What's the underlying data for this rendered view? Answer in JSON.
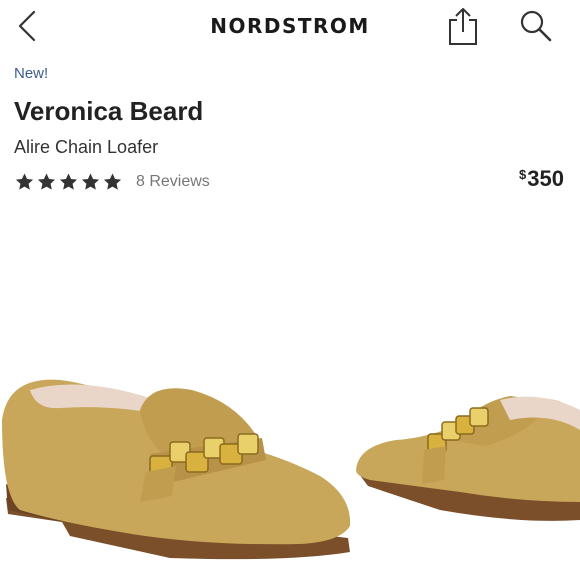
{
  "header": {
    "brand": "NORDSTROM",
    "icons": [
      "chevron-left-icon",
      "share-icon",
      "search-icon"
    ]
  },
  "product": {
    "badge": "New!",
    "brand_name": "Veronica Beard",
    "name": "Alire Chain Loafer",
    "rating": 5,
    "reviews_label": "8 Reviews",
    "price_symbol": "$",
    "price_amount": "350",
    "image": "tan suede chain loafers"
  },
  "colors": {
    "badge": "#3e5a8e",
    "stars": "#333333",
    "suede": "#c8a65a",
    "gold": "#d9b13e"
  }
}
